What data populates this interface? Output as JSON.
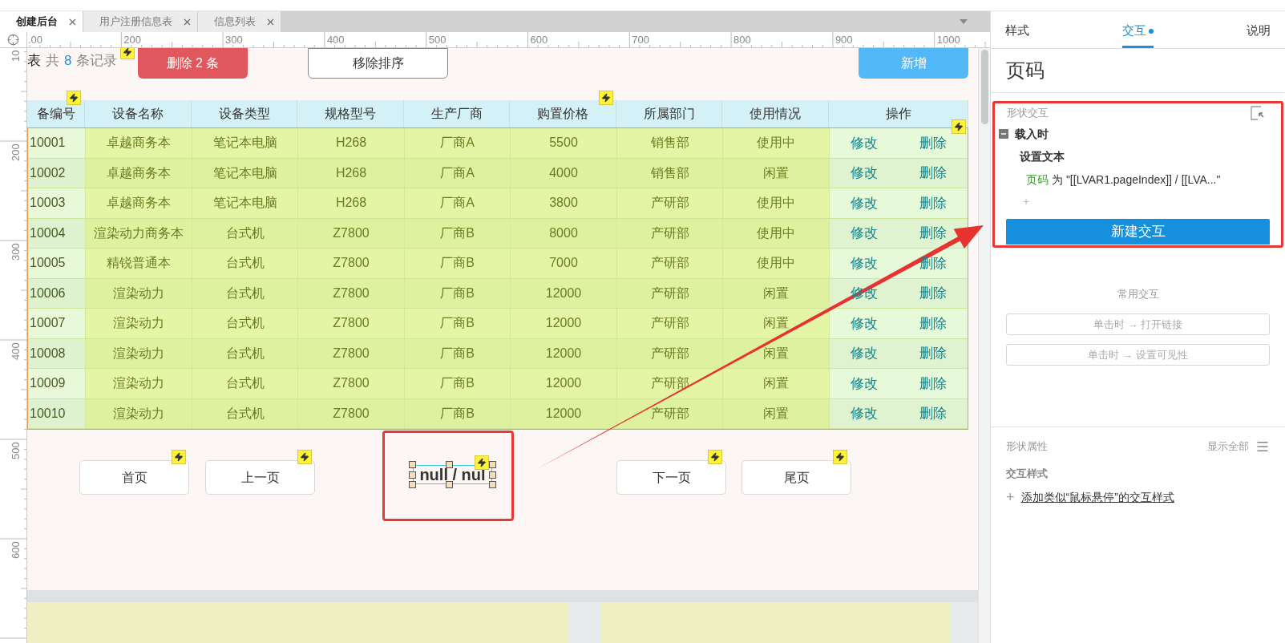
{
  "tabs": [
    {
      "label": "创建后台",
      "selected": true
    },
    {
      "label": "用户注册信息表",
      "selected": false
    },
    {
      "label": "信息列表",
      "selected": false
    }
  ],
  "ruler": {
    "x_labels": [
      ".00",
      "200",
      "300",
      "400",
      "500",
      "600",
      "700",
      "800",
      "900",
      "1000"
    ],
    "y_labels": [
      "10",
      "200",
      "300",
      "400",
      "500",
      "600"
    ]
  },
  "record_count": {
    "prefix": "表",
    "lead": "共",
    "count": "8",
    "unit": "条记录"
  },
  "toolbar_buttons": [
    {
      "label": "删除 2 条",
      "kind": "danger"
    },
    {
      "label": "移除排序",
      "kind": "outline"
    },
    {
      "label": "新增",
      "kind": "primary"
    }
  ],
  "table": {
    "columns": [
      "备编号",
      "设备名称",
      "设备类型",
      "规格型号",
      "生产厂商",
      "购置价格",
      "所属部门",
      "使用情况",
      "操作"
    ],
    "rows": [
      {
        "cells": [
          "10001",
          "卓越商务本",
          "笔记本电脑",
          "H268",
          "厂商A",
          "5500",
          "销售部",
          "使用中"
        ],
        "actions": [
          "修改",
          "删除"
        ]
      },
      {
        "cells": [
          "10002",
          "卓越商务本",
          "笔记本电脑",
          "H268",
          "厂商A",
          "4000",
          "销售部",
          "闲置"
        ],
        "actions": [
          "修改",
          "删除"
        ]
      },
      {
        "cells": [
          "10003",
          "卓越商务本",
          "笔记本电脑",
          "H268",
          "厂商A",
          "3800",
          "产研部",
          "使用中"
        ],
        "actions": [
          "修改",
          "删除"
        ]
      },
      {
        "cells": [
          "10004",
          "渲染动力商务本",
          "台式机",
          "Z7800",
          "厂商B",
          "8000",
          "产研部",
          "使用中"
        ],
        "actions": [
          "修改",
          "删除"
        ]
      },
      {
        "cells": [
          "10005",
          "精锐普通本",
          "台式机",
          "Z7800",
          "厂商B",
          "7000",
          "产研部",
          "使用中"
        ],
        "actions": [
          "修改",
          "删除"
        ]
      },
      {
        "cells": [
          "10006",
          "渲染动力",
          "台式机",
          "Z7800",
          "厂商B",
          "12000",
          "产研部",
          "闲置"
        ],
        "actions": [
          "修改",
          "删除"
        ]
      },
      {
        "cells": [
          "10007",
          "渲染动力",
          "台式机",
          "Z7800",
          "厂商B",
          "12000",
          "产研部",
          "闲置"
        ],
        "actions": [
          "修改",
          "删除"
        ]
      },
      {
        "cells": [
          "10008",
          "渲染动力",
          "台式机",
          "Z7800",
          "厂商B",
          "12000",
          "产研部",
          "闲置"
        ],
        "actions": [
          "修改",
          "删除"
        ]
      },
      {
        "cells": [
          "10009",
          "渲染动力",
          "台式机",
          "Z7800",
          "厂商B",
          "12000",
          "产研部",
          "闲置"
        ],
        "actions": [
          "修改",
          "删除"
        ]
      },
      {
        "cells": [
          "10010",
          "渲染动力",
          "台式机",
          "Z7800",
          "厂商B",
          "12000",
          "产研部",
          "闲置"
        ],
        "actions": [
          "修改",
          "删除"
        ]
      }
    ]
  },
  "pager": {
    "buttons": [
      "首页",
      "上一页",
      "下一页",
      "尾页"
    ],
    "page_text": "null / nul"
  },
  "panel": {
    "tabs": [
      {
        "label": "样式",
        "selected": false,
        "badge": false
      },
      {
        "label": "交互",
        "selected": true,
        "badge": true
      },
      {
        "label": "说明",
        "selected": false,
        "badge": false
      }
    ],
    "title": "页码",
    "interactions": {
      "heading": "形状交互",
      "events": [
        {
          "name": "载入时",
          "expanded": true,
          "actions": [
            {
              "name": "设置文本",
              "target": "页码",
              "detail": "为 \"[[LVAR1.pageIndex]] / [[LVA...\""
            }
          ]
        }
      ],
      "add_symbol": "+",
      "new_button": "新建交互"
    },
    "common": {
      "heading": "常用交互",
      "buttons": [
        "单击时 → 打开链接",
        "单击时 → 设置可见性"
      ]
    },
    "properties": {
      "heading": "形状属性",
      "show_all": "显示全部",
      "style_heading": "交互样式",
      "add_symbol": "+",
      "add_link": "添加类似“鼠标悬停”的交互样式"
    }
  }
}
